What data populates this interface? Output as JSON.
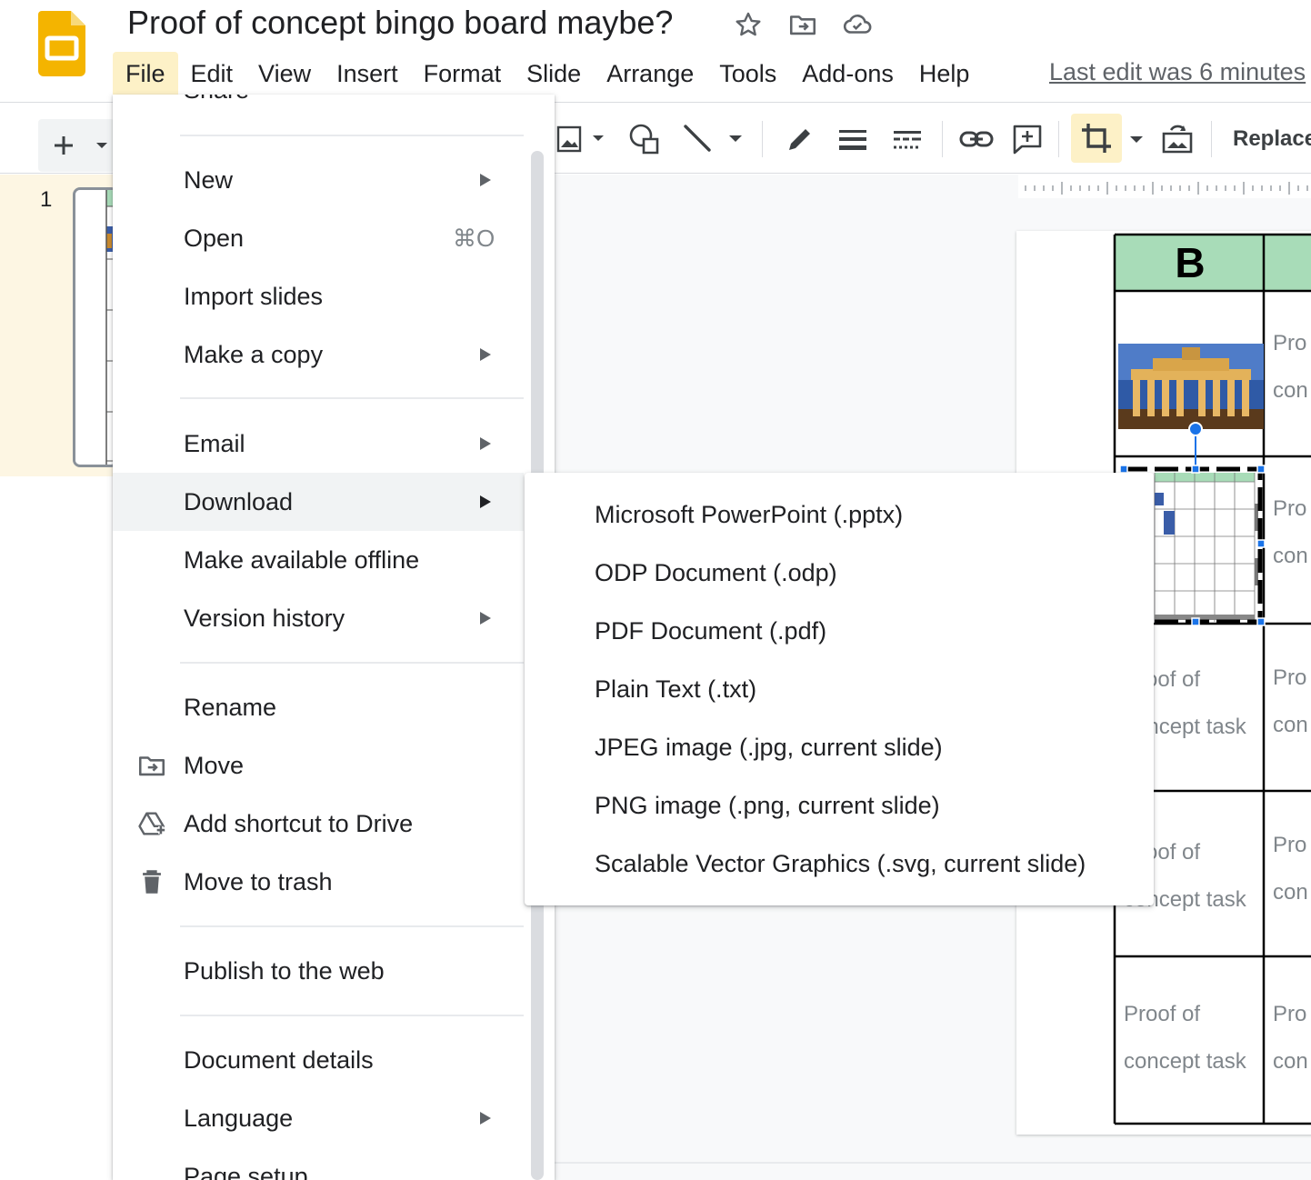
{
  "header": {
    "title": "Proof of concept bingo board maybe?",
    "menus": [
      "File",
      "Edit",
      "View",
      "Insert",
      "Format",
      "Slide",
      "Arrange",
      "Tools",
      "Add-ons",
      "Help"
    ],
    "last_edit": "Last edit was 6 minutes"
  },
  "toolbar": {
    "new_slide_icon": "plus-icon",
    "replace_label": "Replace",
    "icons": [
      "image-icon",
      "shape-icon",
      "line-icon",
      "pen-icon",
      "line-weight-icon",
      "line-dash-icon",
      "link-icon",
      "comment-icon",
      "crop-icon",
      "reset-image-icon"
    ]
  },
  "filmstrip": {
    "slide_number": "1"
  },
  "slide": {
    "header_letter": "B",
    "cell_texts": [
      [
        "Proof of",
        "concept task"
      ],
      [
        "Proof of",
        "concept task"
      ],
      [
        "Proof of",
        "concept task"
      ]
    ],
    "partial_text": [
      "Pro",
      "con"
    ],
    "colors": {
      "header_green": "#a8dcb8",
      "selection_blue": "#1a73e8"
    }
  },
  "file_menu": {
    "partial_top": "Share",
    "items": [
      {
        "label": "New",
        "submenu": true
      },
      {
        "label": "Open",
        "shortcut": "⌘O"
      },
      {
        "label": "Import slides"
      },
      {
        "label": "Make a copy",
        "submenu": true
      },
      {
        "label": "Email",
        "submenu": true
      },
      {
        "label": "Download",
        "submenu": true,
        "highlighted": true
      },
      {
        "label": "Make available offline"
      },
      {
        "label": "Version history",
        "submenu": true
      },
      {
        "label": "Rename"
      },
      {
        "label": "Move",
        "icon": "folder-move-icon"
      },
      {
        "label": "Add shortcut to Drive",
        "icon": "drive-shortcut-icon"
      },
      {
        "label": "Move to trash",
        "icon": "trash-icon"
      },
      {
        "label": "Publish to the web"
      },
      {
        "label": "Document details"
      },
      {
        "label": "Language",
        "submenu": true
      },
      {
        "label": "Page setup"
      }
    ]
  },
  "download_submenu": {
    "items": [
      "Microsoft PowerPoint (.pptx)",
      "ODP Document (.odp)",
      "PDF Document (.pdf)",
      "Plain Text (.txt)",
      "JPEG image (.jpg, current slide)",
      "PNG image (.png, current slide)",
      "Scalable Vector Graphics (.svg, current slide)"
    ]
  }
}
